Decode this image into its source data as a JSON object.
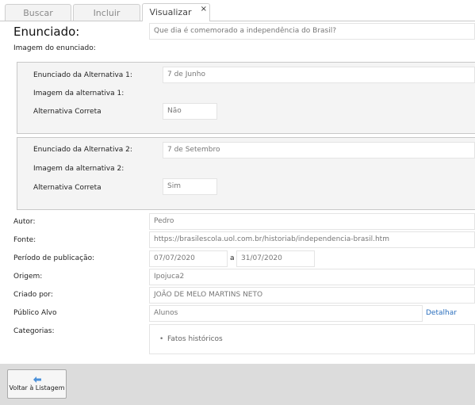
{
  "tabs": [
    {
      "label": "Buscar"
    },
    {
      "label": "Incluir"
    },
    {
      "label": "Visualizar",
      "close": "×"
    }
  ],
  "question": {
    "title": "Enunciado:",
    "text": "Que dia é comemorado a independência do Brasil?",
    "image_label": "Imagem do enunciado:"
  },
  "alternatives": [
    {
      "statement_label": "Enunciado da Alternativa 1:",
      "statement_value": "7 de Junho",
      "image_label": "Imagem da alternativa 1:",
      "correct_label": "Alternativa Correta",
      "correct_value": "Não"
    },
    {
      "statement_label": "Enunciado da Alternativa 2:",
      "statement_value": "7 de Setembro",
      "image_label": "Imagem da alternativa 2:",
      "correct_label": "Alternativa Correta",
      "correct_value": "Sim"
    }
  ],
  "meta": {
    "author_label": "Autor:",
    "author_value": "Pedro",
    "source_label": "Fonte:",
    "source_value": "https://brasilescola.uol.com.br/historiab/independencia-brasil.htm",
    "period_label": "Período de publicação:",
    "period_from": "07/07/2020",
    "period_sep": "a",
    "period_to": "31/07/2020",
    "origin_label": "Origem:",
    "origin_value": "Ipojuca2",
    "created_label": "Criado por:",
    "created_value": "JOÃO DE MELO MARTINS NETO",
    "audience_label": "Público Alvo",
    "audience_value": "Alunos",
    "audience_link": "Detalhar",
    "categories_label": "Categorias:",
    "categories": [
      "Fatos históricos"
    ]
  },
  "footer": {
    "back_label": "Voltar à Listagem",
    "back_icon": "back-arrow-icon"
  }
}
